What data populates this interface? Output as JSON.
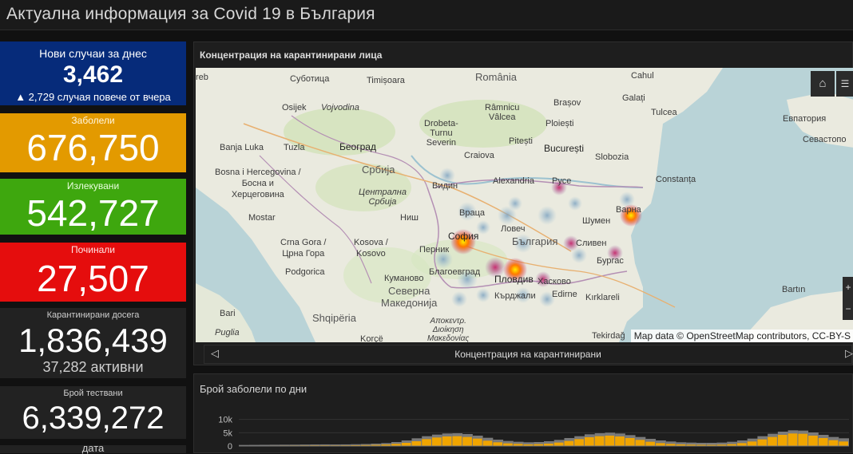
{
  "header": {
    "title": "Актуална информация за Covid 19 в България"
  },
  "cards": {
    "new": {
      "label": "Нови случаи за днес",
      "value": "3,462",
      "sub": "▲ 2,729 случая повече от вчера",
      "color": "#062b7a"
    },
    "sick": {
      "label": "Заболели",
      "value": "676,750",
      "color": "#e39a00"
    },
    "cured": {
      "label": "Излекувани",
      "value": "542,727",
      "color": "#3ea70e"
    },
    "dead": {
      "label": "Починали",
      "value": "27,507",
      "color": "#e50d0d"
    },
    "quarantined": {
      "label": "Карантинирани досега",
      "value": "1,836,439",
      "sub": "37,282 активни"
    },
    "tests": {
      "label": "Брой тествани",
      "value": "6,339,272"
    },
    "date": {
      "label": "дата"
    }
  },
  "map_panel": {
    "title": "Концентрация на карантинирани лица",
    "attribution": "Map data © OpenStreetMap contributors, CC-BY-S",
    "home_icon": "home-icon",
    "list_icon": "list-icon",
    "zoom_in": "+",
    "zoom_out": "−",
    "carousel_label": "Концентрация на карантинирани",
    "prev_icon": "◁",
    "next_icon": "▷",
    "labels": {
      "reb": "reb",
      "subotica": "Суботица",
      "timisoara": "Timișoara",
      "romania": "România",
      "brasov": "Brașov",
      "cahul": "Cahul",
      "galati": "Galați",
      "osijek": "Osijek",
      "vojvodina": "Vojvodina",
      "ramnicu": "Râmnicu\nVâlcea",
      "ploiesti": "Ploiești",
      "tulcea": "Tulcea",
      "evpatoria": "Евпатория",
      "drobeta": "Drobeta-\nTurnu\nSeverin",
      "pitesti": "Pitești",
      "sevastopol": "Севастопо",
      "banjaluka": "Banja Luka",
      "tuzla": "Tuzla",
      "belgrade": "Београд",
      "craiova": "Craiova",
      "bucuresti": "București",
      "slobozia": "Slobozia",
      "bosnia": "Bosna i Hercegovina /\nБосна и\nХерцеговина",
      "srbija": "Србија",
      "constanta": "Constanța",
      "vidin": "Видин",
      "alexandria": "Alexandria",
      "ruse": "Русе",
      "centralna": "Централна\nСрбија",
      "vratsa": "Враца",
      "shumen": "Шумен",
      "varna": "Варна",
      "mostar": "Mostar",
      "nis": "Ниш",
      "lovech": "Ловеч",
      "sofia": "София",
      "bulgaria": "България",
      "sliven": "Сливен",
      "burgas": "Бургас",
      "crnagora": "Crna Gora /\nЦрна Гора",
      "kosovo": "Kosova /\nKosovo",
      "pernik": "Перник",
      "blagoevgrad": "Благоевград",
      "plovdiv": "Пловдив",
      "haskovo": "Хасково",
      "podgorica": "Podgorica",
      "kumanovo": "Куманово",
      "kardzhali": "Кърджали",
      "edirne": "Edirne",
      "kirklareli": "Kırklareli",
      "bartin": "Bartın",
      "severna": "Северна\nМакедонија",
      "bari": "Bari",
      "shqiperia": "Shqipëria",
      "apokentr": "Αποκεντρ.\nΔιοίκηση\nΜακεδονίας",
      "tekirdag": "Tekirdağ",
      "puglia": "Puglia",
      "korce": "Korçë"
    }
  },
  "chart_panel": {
    "title": "Брой заболели по дни",
    "chart_data": {
      "type": "area",
      "ylabel": "",
      "xlabel": "",
      "ytick_labels": [
        "10k",
        "5k",
        "0"
      ],
      "yticks": [
        10000,
        5000,
        0
      ],
      "ylim": [
        0,
        12000
      ],
      "series": [
        {
          "color": "#f0a500",
          "values": [
            120,
            140,
            150,
            160,
            180,
            200,
            220,
            250,
            260,
            240,
            260,
            300,
            350,
            420,
            550,
            800,
            1200,
            1800,
            2600,
            3200,
            3600,
            3700,
            3400,
            2800,
            2000,
            1400,
            1000,
            800,
            600,
            700,
            900,
            1300,
            1900,
            2600,
            3300,
            3700,
            3900,
            3600,
            3000,
            2300,
            1600,
            1100,
            800,
            600,
            500,
            450,
            420,
            500,
            700,
            1100,
            1700,
            2500,
            3400,
            4200,
            4700,
            4600,
            3900,
            3000,
            2200,
            1700
          ]
        },
        {
          "color": "#9a9a9a",
          "values": [
            400,
            420,
            450,
            480,
            500,
            520,
            560,
            600,
            620,
            600,
            620,
            680,
            760,
            900,
            1100,
            1500,
            2100,
            2900,
            3700,
            4300,
            4700,
            4800,
            4500,
            3900,
            3100,
            2400,
            1900,
            1600,
            1400,
            1500,
            1800,
            2300,
            3000,
            3700,
            4400,
            4800,
            5000,
            4700,
            4100,
            3400,
            2700,
            2100,
            1700,
            1400,
            1300,
            1200,
            1200,
            1300,
            1600,
            2100,
            2800,
            3700,
            4600,
            5400,
            5900,
            5800,
            5100,
            4200,
            3400,
            2900
          ]
        }
      ]
    }
  }
}
